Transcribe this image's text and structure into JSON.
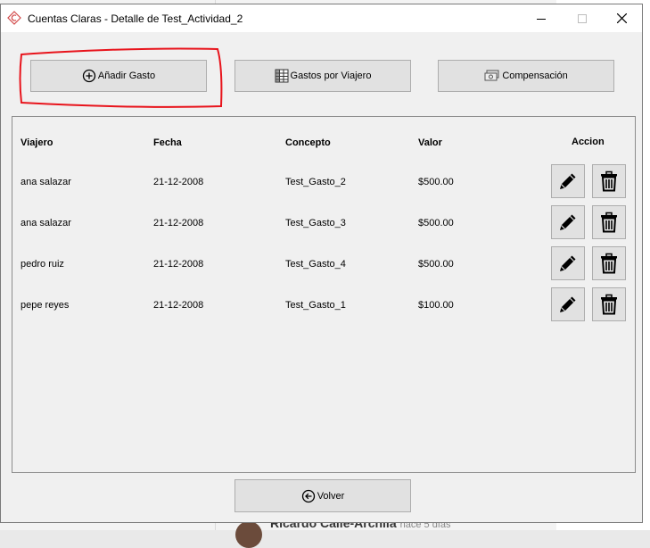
{
  "background": {
    "author_name": "Ricardo Calle-Archila",
    "author_time": "hace 5 días"
  },
  "window": {
    "title": "Cuentas Claras - Detalle de Test_Actividad_2",
    "app_icon": "cuentas-claras-logo",
    "controls": [
      "minimize-icon",
      "maximize-icon",
      "close-icon"
    ]
  },
  "toolbar": {
    "add_label": "Añadir Gasto",
    "add_icon": "plus-circle-icon",
    "travelers_label": "Gastos por Viajero",
    "travelers_icon": "spreadsheet-icon",
    "compensation_label": "Compensación",
    "compensation_icon": "money-icon"
  },
  "table": {
    "headers": {
      "traveler": "Viajero",
      "date": "Fecha",
      "concept": "Concepto",
      "value": "Valor",
      "action": "Accion"
    },
    "rows": [
      {
        "traveler": "ana salazar",
        "date": "21-12-2008",
        "concept": "Test_Gasto_2",
        "value": "$500.00"
      },
      {
        "traveler": "ana salazar",
        "date": "21-12-2008",
        "concept": "Test_Gasto_3",
        "value": "$500.00"
      },
      {
        "traveler": "pedro ruiz",
        "date": "21-12-2008",
        "concept": "Test_Gasto_4",
        "value": "$500.00"
      },
      {
        "traveler": "pepe reyes",
        "date": "21-12-2008",
        "concept": "Test_Gasto_1",
        "value": "$100.00"
      }
    ],
    "row_actions": [
      "pencil-icon",
      "trash-icon"
    ]
  },
  "footer": {
    "back_label": "Volver",
    "back_icon": "arrow-left-circle-icon"
  },
  "colors": {
    "highlight": "#e8141c",
    "window_bg": "#f0f0f0",
    "button_bg": "#e1e1e1",
    "logo": "#d24b4b"
  }
}
